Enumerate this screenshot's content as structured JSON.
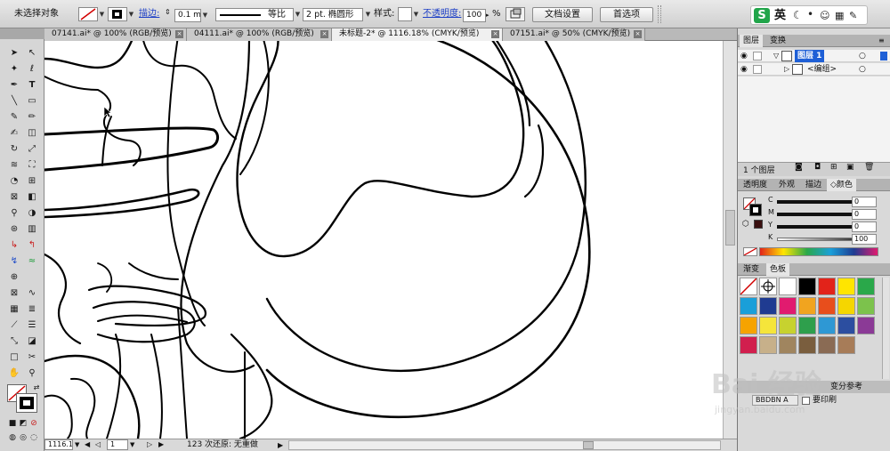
{
  "control_bar": {
    "selection_label": "未选择对象",
    "stroke_link": "描边:",
    "stroke_weight": "0.1 mr",
    "profile_label": "等比",
    "brush_label": "2 pt. 椭圆形",
    "style_label": "样式:",
    "opacity_link": "不透明度:",
    "opacity_value": "100",
    "opacity_unit": "%",
    "doc_setup_button": "文档设置",
    "prefs_button": "首选项"
  },
  "ime_bar": {
    "logo": "S",
    "lang": "英"
  },
  "tabs": [
    {
      "label": "07141.ai* @ 100% (RGB/预览)",
      "active": false
    },
    {
      "label": "04111.ai* @ 100% (RGB/预览)",
      "active": false
    },
    {
      "label": "未标题-2* @ 1116.18% (CMYK/预览)",
      "active": true
    },
    {
      "label": "07151.ai* @ 50% (CMYK/预览)",
      "active": false
    }
  ],
  "tab_close": "×",
  "layers_panel": {
    "tabs": [
      "图层",
      "变换"
    ],
    "rows": [
      {
        "name": "图层 1"
      },
      {
        "name": "<编组>"
      }
    ],
    "footer": "1 个图层"
  },
  "color_panel": {
    "tabs": [
      "透明度",
      "外观",
      "描边",
      "◇颜色"
    ],
    "channels": [
      {
        "label": "C",
        "value": "0"
      },
      {
        "label": "M",
        "value": "0"
      },
      {
        "label": "Y",
        "value": "0"
      },
      {
        "label": "K",
        "value": "100"
      }
    ]
  },
  "swatch_panel": {
    "tabs": [
      "渐变",
      "色板"
    ],
    "colors": [
      "#ffffff",
      "#ffffff",
      "#ffffff",
      "#000000",
      "#e2231a",
      "#ffe500",
      "#2aa84a",
      "#1a9fd9",
      "#1f3b91",
      "#e11b6f",
      "#f1a41f",
      "#e84e1c",
      "#f5d600",
      "#7cc24c",
      "#f6a300",
      "#f5e53a",
      "#c7d22f",
      "#2e9f4c",
      "#2e98d4",
      "#2c4ea0",
      "#8b3a96",
      "#d11f4e",
      "#c7b08a",
      "#a0855f",
      "#7a5e3e",
      "#8a6b54",
      "#a77c58"
    ],
    "bottom_text": "要印刷",
    "panel_hint": "变分参考",
    "mini_label": "BBDBN A"
  },
  "status_bar": {
    "zoom": "1116.18",
    "page": "1",
    "info": "123 次还原: 无重做"
  },
  "watermark": {
    "text": "Bai 经验",
    "url": "jingyan.baidu.com"
  }
}
